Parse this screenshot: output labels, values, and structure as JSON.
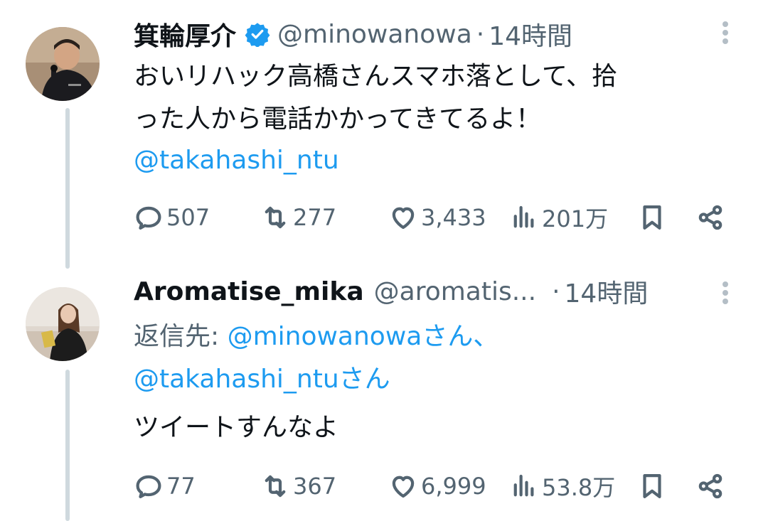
{
  "tweets": [
    {
      "name": "箕輪厚介",
      "handle": "@minowanowa",
      "time": "14時間",
      "verified": true,
      "lines": [
        "おいリハック高橋さんスマホ落として、拾",
        "った人から電話かかってきてるよ！"
      ],
      "mention": "@takahashi_ntu",
      "replies": "507",
      "retweets": "277",
      "likes": "3,433",
      "views": "201万"
    },
    {
      "name": "Aromatise_mika",
      "handle": "@aromatis...",
      "time": "14時間",
      "reply_prefix": "返信先: ",
      "reply_to_1": "@minowanowaさん、",
      "reply_to_2": "@takahashi_ntuさん",
      "body": "ツイートすんなよ",
      "replies": "77",
      "retweets": "367",
      "likes": "6,999",
      "views": "53.8万"
    }
  ],
  "colors": {
    "accent": "#1d9bf0",
    "muted": "#536471",
    "thread": "#cfd9de"
  },
  "icons": [
    "verified-badge-icon",
    "more-icon",
    "reply-icon",
    "retweet-icon",
    "like-icon",
    "views-icon",
    "bookmark-icon",
    "share-icon"
  ]
}
